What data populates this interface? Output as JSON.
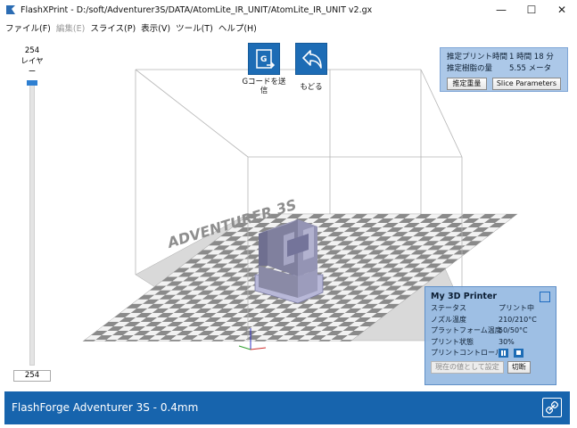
{
  "window": {
    "title": "FlashXPrint - D:/soft/Adventurer3S/DATA/AtomLite_IR_UNIT/AtomLite_IR_UNIT v2.gx",
    "controls": {
      "minimize": "—",
      "maximize": "☐",
      "close": "✕"
    }
  },
  "menu": [
    {
      "label": "ファイル(F)",
      "enabled": true
    },
    {
      "label": "編集(E)",
      "enabled": false
    },
    {
      "label": "スライス(P)",
      "enabled": true
    },
    {
      "label": "表示(V)",
      "enabled": true
    },
    {
      "label": "ツール(T)",
      "enabled": true
    },
    {
      "label": "ヘルプ(H)",
      "enabled": true
    }
  ],
  "layer_slider": {
    "top_value": "254",
    "caption": "レイヤー",
    "bottom_value": "254"
  },
  "toolbar": {
    "send_gcode_label": "Gコードを送信",
    "back_label": "もどる",
    "icons": {
      "send": "gcode-send-icon",
      "back": "undo-arrow-icon"
    }
  },
  "viewport": {
    "platform_brand": "ADVENTURER 3S",
    "colors": {
      "accent": "#1d6cb5",
      "checker_dark": "#8a8a8a",
      "checker_light": "#f2f2f2",
      "model": "#8a8aa6"
    }
  },
  "estimate": {
    "time_label": "推定プリント時間",
    "time_value": "1 時間 18 分",
    "filament_label": "推定樹脂の量",
    "filament_value": "5.55 メータ",
    "weight_button": "推定重量",
    "slice_button": "Slice Parameters"
  },
  "printer": {
    "name": "My 3D Printer",
    "status_label": "ステータス",
    "status_value": "プリント中",
    "nozzle_label": "ノズル温度",
    "nozzle_value": "210/210°C",
    "platform_label": "プラットフォーム温度",
    "platform_value": "50/50°C",
    "progress_label": "プリント状態",
    "progress_value": "30%",
    "control_label": "プリントコントロール",
    "set_current_button": "現在の値として設定",
    "disconnect_button": "切断"
  },
  "statusbar": {
    "printer_model": "FlashForge Adventurer 3S - 0.4mm"
  }
}
